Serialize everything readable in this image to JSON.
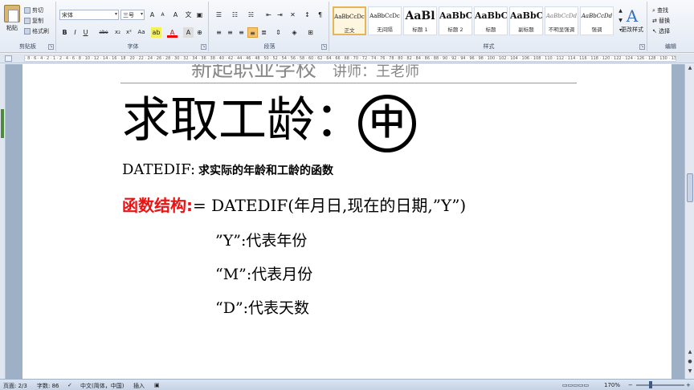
{
  "ribbon": {
    "clipboard": {
      "paste_label": "粘贴",
      "cut_label": "剪切",
      "copy_label": "复制",
      "format_painter_label": "格式刷",
      "group_label": "剪贴板"
    },
    "font": {
      "font_name": "宋体",
      "font_size": "三号",
      "group_label": "字体",
      "bold": "B",
      "italic": "I",
      "underline": "U",
      "strike": "abe",
      "subscript": "x₂",
      "superscript": "x²",
      "change_case": "Aa",
      "grow": "A",
      "shrink": "A",
      "clear": "A"
    },
    "paragraph": {
      "group_label": "段落"
    },
    "styles": {
      "group_label": "样式",
      "items": [
        {
          "sample": "AaBbCcDc",
          "name": "正文"
        },
        {
          "sample": "AaBbCcDc",
          "name": "无间隔"
        },
        {
          "sample": "AaBl",
          "name": "标题 1"
        },
        {
          "sample": "AaBbC",
          "name": "标题 2"
        },
        {
          "sample": "AaBbC",
          "name": "标题"
        },
        {
          "sample": "AaBbC",
          "name": "副标题"
        },
        {
          "sample": "AaBbCcDd",
          "name": "不明显强调"
        },
        {
          "sample": "AaBbCcDd",
          "name": "强调"
        }
      ],
      "change_styles_label": "更改样式"
    },
    "editing": {
      "group_label": "编辑",
      "find_label": "查找",
      "replace_label": "替换",
      "select_label": "选择"
    }
  },
  "ruler": {
    "ticks": "· 8 · 6 · 4 · 2 · 1 · 2 · 4 · 6 · 8 · 10 · 12 · 14 · 16 · 18 · 20 · 22 · 24 · 26 · 28 · 30 · 32 · 34 · 36 · 38 · 40 · 42 · 44 · 46 · 48 · 50 · 52 · 54 · 56 · 58 · 60 · 62 · 64 · 66 · 68 · 70 · 72 · 74 · 76 · 78 · 80 · 82 · 84 · 86 · 88 · 90 · 92 · 94 · 96 · 98 · 100 · 102 · 104 · 106 · 108 · 110 · 112 · 114 · 116 · 118 · 120 · 122 · 124 · 126 · 128 · 130 · 132 · 134 · 136 · 138 · 140 · 142 · 144 · 146 · 148 · 150"
  },
  "document": {
    "header_main": "新起职业学校",
    "header_sub": "讲师：王老师",
    "title": "求取工龄：",
    "title_badge": "中",
    "datedif_keyword": "DATEDIF:",
    "datedif_desc": "求实际的年龄和工龄的函数",
    "formula_label": "函数结构:",
    "formula_body": "= DATEDIF(年月日,现在的日期,”Y”)",
    "code_lines": [
      "”Y”:代表年份",
      "“M”:代表月份",
      "“D”:代表天数"
    ]
  },
  "status": {
    "page": "页面: 2/3",
    "words": "字数: 86",
    "language": "中文(简体，中国)",
    "mode": "插入",
    "zoom": "170%"
  }
}
